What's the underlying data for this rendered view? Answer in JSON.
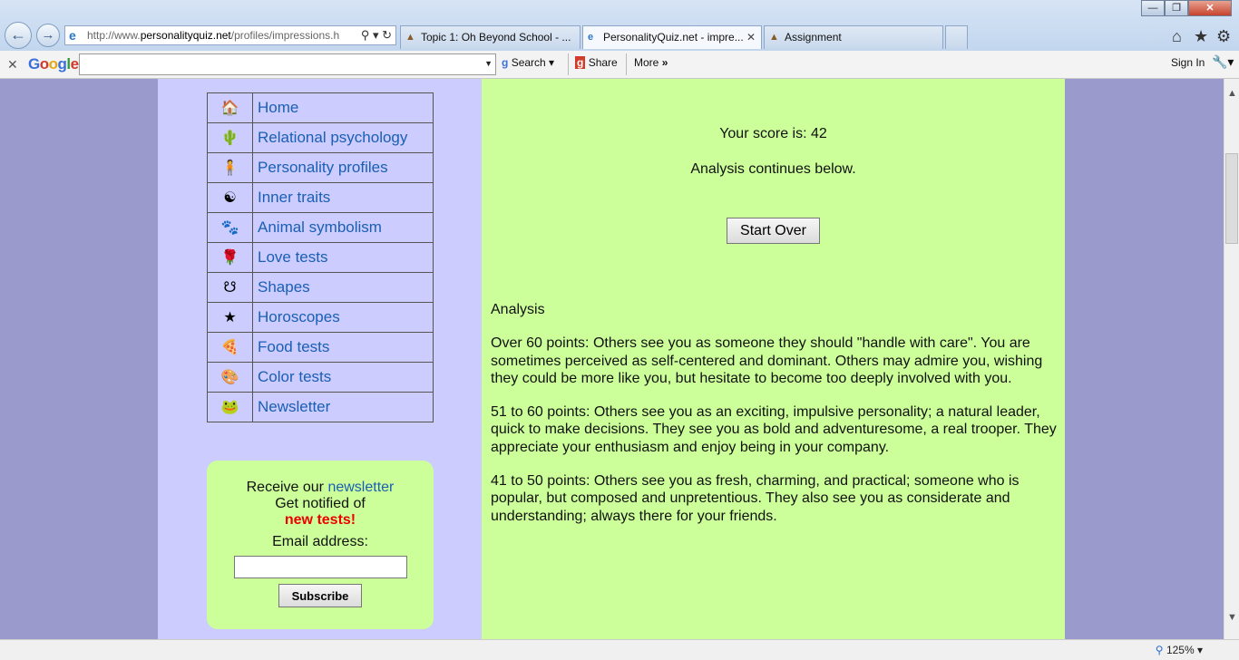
{
  "browser": {
    "address": {
      "prefix": "http://www.",
      "domain": "personalityquiz.net",
      "path": "/profiles/impressions.h"
    },
    "tabs": [
      {
        "label": "Topic 1: Oh Beyond School - ..."
      },
      {
        "label": "PersonalityQuiz.net - impre..."
      },
      {
        "label": "Assignment"
      }
    ],
    "google_bar": {
      "logo": "Google",
      "search_label": "Search",
      "share_label": "Share",
      "more_label": "More",
      "sign_in_label": "Sign In"
    },
    "zoom": "125%"
  },
  "nav": {
    "items": [
      {
        "label": "Home",
        "icon": "house-icon",
        "glyph": "🏠"
      },
      {
        "label": "Relational psychology",
        "icon": "cactus-icon",
        "glyph": "🌵"
      },
      {
        "label": "Personality profiles",
        "icon": "person-icon",
        "glyph": "🧍"
      },
      {
        "label": "Inner traits",
        "icon": "yin-yang-icon",
        "glyph": "☯"
      },
      {
        "label": "Animal symbolism",
        "icon": "paw-icon",
        "glyph": "🐾"
      },
      {
        "label": "Love tests",
        "icon": "rose-icon",
        "glyph": "🌹"
      },
      {
        "label": "Shapes",
        "icon": "symbol-icon",
        "glyph": "☋"
      },
      {
        "label": "Horoscopes",
        "icon": "star-icon",
        "glyph": "★"
      },
      {
        "label": "Food tests",
        "icon": "pizza-icon",
        "glyph": "🍕"
      },
      {
        "label": "Color tests",
        "icon": "palette-icon",
        "glyph": "🎨"
      },
      {
        "label": "Newsletter",
        "icon": "frog-icon",
        "glyph": "🐸"
      }
    ]
  },
  "newsletter": {
    "line1_prefix": "Receive our ",
    "line1_link": "newsletter",
    "line2": "Get notified of",
    "line3": "new tests!",
    "email_label": "Email address:",
    "email_value": "",
    "subscribe_label": "Subscribe"
  },
  "result": {
    "score_text": "Your score is: 42",
    "continues_text": "Analysis continues below.",
    "start_over_label": "Start Over"
  },
  "analysis": {
    "heading": "Analysis",
    "paragraphs": [
      "Over 60 points: Others see you as someone they should \"handle with care\". You are sometimes perceived as self-centered and dominant. Others may admire you, wishing they could be more like you, but hesitate to become too deeply involved with you.",
      "51 to 60 points: Others see you as an exciting, impulsive personality; a natural leader, quick to make decisions. They see you as bold and adventuresome, a real trooper. They appreciate your enthusiasm and enjoy being in your company.",
      "41 to 50 points: Others see you as fresh, charming, and practical; someone who is popular, but composed and unpretentious. They also see you as considerate and understanding; always there for your friends."
    ]
  },
  "colors": {
    "sidebar_bg": "#ccccff",
    "main_bg": "#ccff99",
    "page_bg": "#9a9acc",
    "link": "#1a5fb4",
    "highlight": "#ee0000"
  }
}
